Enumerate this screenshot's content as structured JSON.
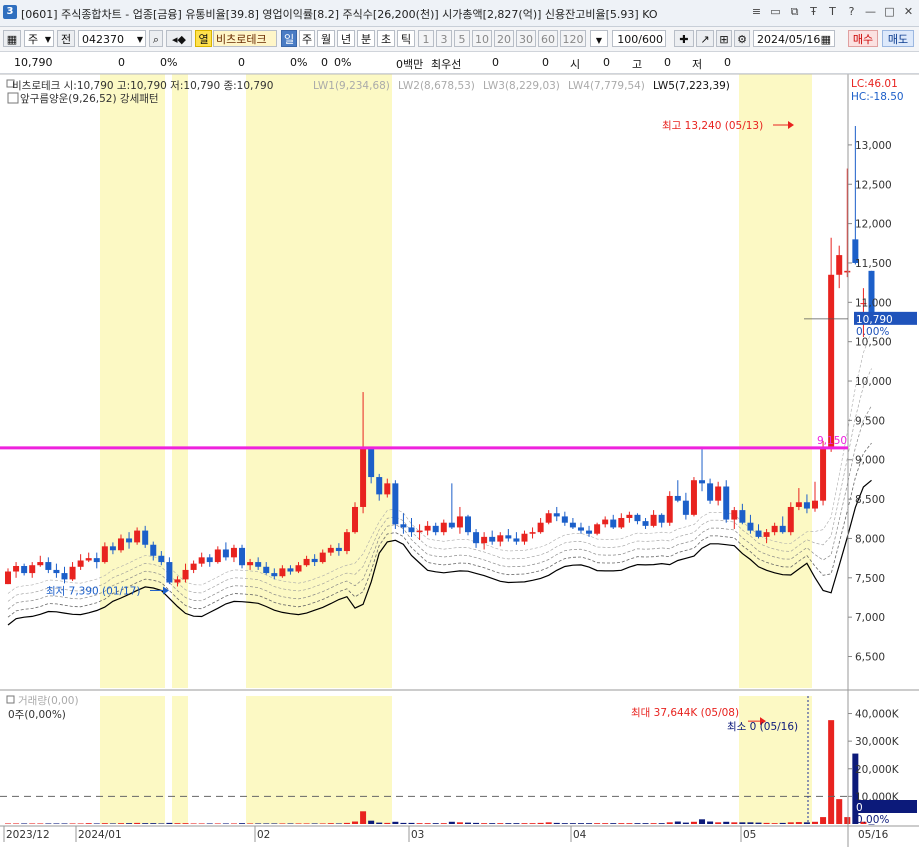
{
  "window": {
    "icon_label": "3",
    "title": "[0601] 주식종합차트 - 업종[금융] 유통비율[39.8] 영업이익률[8.2] 주식수[26,200(천)] 시가총액[2,827(억)] 신용잔고비율[5.93] KO",
    "controls": [
      "≡",
      "▭",
      "⧉",
      "Ŧ",
      "T",
      "?",
      "—",
      "□",
      "✕"
    ]
  },
  "toolbar": {
    "type_select": "주",
    "prev_label": "전",
    "stock_code": "042370",
    "open_label": "열",
    "stock_name": "비츠로테크",
    "periods": [
      "일",
      "주",
      "월",
      "년",
      "분",
      "초",
      "틱"
    ],
    "active_period": "일",
    "intervals": [
      "1",
      "3",
      "5",
      "10",
      "20",
      "30",
      "60",
      "120"
    ],
    "count": "100",
    "count_total": "/600",
    "date": "2024/05/16",
    "buy_label": "매수",
    "sell_label": "매도"
  },
  "quote": {
    "price": "10,790",
    "change": "0",
    "change_pct": "0%",
    "open_val": "0",
    "open_pct": "0%",
    "vol_val": "0",
    "vol_pct": "0%",
    "amount": "0백만",
    "best_label": "최우선",
    "best_val": "0",
    "f1": "0",
    "si_label": "시",
    "si_val": "0",
    "go_label": "고",
    "go_val": "0",
    "jeo_label": "저",
    "jeo_val": "0"
  },
  "chart_data": {
    "type": "candlestick",
    "price_header": "비츠로테크 시:10,790 고:10,790 저:10,790 종:10,790",
    "lw_labels": [
      "LW1(9,234,68)",
      "LW2(8,678,53)",
      "LW3(8,229,03)",
      "LW4(7,779,54)",
      "LW5(7,223,39)"
    ],
    "pattern_label": "앞구름양운(9,26,52) 강세패턴",
    "lc_label": "LC:46.01",
    "hc_label": "HC:-18.50",
    "price_ticks": [
      13000,
      12500,
      12000,
      11500,
      11000,
      10500,
      10000,
      9500,
      9000,
      8500,
      8000,
      7500,
      7000,
      6500
    ],
    "price_tick_labels": [
      "13,000",
      "12,500",
      "12,000",
      "11,500",
      "11,000",
      "10,500",
      "10,000",
      "9,500",
      "9,000",
      "8,500",
      "8,000",
      "7,500",
      "7,000",
      "6,500"
    ],
    "ylim": [
      6100,
      13850
    ],
    "current_price": 10790,
    "current_price_label": "10,790",
    "current_change_label": "0.00%",
    "resistance": 9150,
    "resistance_label": "9,150",
    "high_label": "최고 13,240 (05/13)",
    "low_label": "최저 7,390 (01/17)",
    "x_labels": [
      "2023/12",
      "2024/01",
      "02",
      "03",
      "04",
      "05"
    ],
    "x_right_label": "05/16",
    "volume_title": "거래량(0,00)",
    "volume_sub": "0주(0,00%)",
    "volume_ticks": [
      "40,000K",
      "30,000K",
      "20,000K",
      "10,000K"
    ],
    "volume_max_label": "최대 37,644K (05/08)",
    "volume_min_label": "최소 0 (05/16)",
    "volume_current": "0",
    "volume_current_pct": "0.00%",
    "candles": [
      [
        7420,
        7620,
        7420,
        7580
      ],
      [
        7580,
        7700,
        7500,
        7650
      ],
      [
        7650,
        7680,
        7530,
        7560
      ],
      [
        7560,
        7700,
        7500,
        7660
      ],
      [
        7660,
        7780,
        7640,
        7700
      ],
      [
        7700,
        7760,
        7560,
        7600
      ],
      [
        7600,
        7680,
        7500,
        7560
      ],
      [
        7560,
        7640,
        7430,
        7480
      ],
      [
        7480,
        7700,
        7460,
        7640
      ],
      [
        7640,
        7800,
        7600,
        7720
      ],
      [
        7720,
        7820,
        7700,
        7750
      ],
      [
        7750,
        7820,
        7620,
        7700
      ],
      [
        7700,
        7950,
        7680,
        7900
      ],
      [
        7900,
        7950,
        7800,
        7850
      ],
      [
        7850,
        8050,
        7820,
        8000
      ],
      [
        8000,
        8080,
        7870,
        7950
      ],
      [
        7950,
        8140,
        7920,
        8100
      ],
      [
        8100,
        8160,
        7880,
        7920
      ],
      [
        7920,
        7960,
        7720,
        7780
      ],
      [
        7780,
        7840,
        7660,
        7700
      ],
      [
        7700,
        7760,
        7420,
        7440
      ],
      [
        7440,
        7520,
        7390,
        7480
      ],
      [
        7480,
        7680,
        7440,
        7600
      ],
      [
        7600,
        7720,
        7560,
        7680
      ],
      [
        7680,
        7820,
        7640,
        7760
      ],
      [
        7760,
        7800,
        7640,
        7700
      ],
      [
        7700,
        7900,
        7680,
        7860
      ],
      [
        7860,
        7950,
        7720,
        7760
      ],
      [
        7760,
        7920,
        7700,
        7880
      ],
      [
        7880,
        7920,
        7620,
        7660
      ],
      [
        7660,
        7740,
        7600,
        7700
      ],
      [
        7700,
        7760,
        7600,
        7640
      ],
      [
        7640,
        7700,
        7540,
        7560
      ],
      [
        7560,
        7620,
        7480,
        7520
      ],
      [
        7520,
        7660,
        7500,
        7620
      ],
      [
        7620,
        7660,
        7540,
        7580
      ],
      [
        7580,
        7700,
        7560,
        7660
      ],
      [
        7660,
        7780,
        7640,
        7740
      ],
      [
        7740,
        7800,
        7650,
        7700
      ],
      [
        7700,
        7860,
        7680,
        7820
      ],
      [
        7820,
        7920,
        7780,
        7880
      ],
      [
        7880,
        7940,
        7780,
        7840
      ],
      [
        7840,
        8120,
        7800,
        8080
      ],
      [
        8080,
        8460,
        8060,
        8400
      ],
      [
        8400,
        9860,
        8320,
        9150
      ],
      [
        9150,
        9160,
        8700,
        8780
      ],
      [
        8780,
        8820,
        8480,
        8560
      ],
      [
        8560,
        8760,
        8520,
        8700
      ],
      [
        8700,
        8740,
        8120,
        8180
      ],
      [
        8180,
        8320,
        8060,
        8140
      ],
      [
        8140,
        8260,
        8020,
        8080
      ],
      [
        8080,
        8180,
        7980,
        8100
      ],
      [
        8100,
        8220,
        8040,
        8160
      ],
      [
        8160,
        8200,
        8040,
        8080
      ],
      [
        8080,
        8240,
        8040,
        8200
      ],
      [
        8200,
        8700,
        8120,
        8140
      ],
      [
        8140,
        8400,
        8060,
        8280
      ],
      [
        8280,
        8300,
        8040,
        8080
      ],
      [
        8080,
        8120,
        7880,
        7940
      ],
      [
        7940,
        8080,
        7860,
        8020
      ],
      [
        8020,
        8100,
        7920,
        7960
      ],
      [
        7960,
        8080,
        7900,
        8040
      ],
      [
        8040,
        8120,
        7960,
        8000
      ],
      [
        8000,
        8080,
        7920,
        7960
      ],
      [
        7960,
        8100,
        7920,
        8060
      ],
      [
        8060,
        8140,
        8000,
        8080
      ],
      [
        8080,
        8260,
        8060,
        8200
      ],
      [
        8200,
        8360,
        8180,
        8320
      ],
      [
        8320,
        8400,
        8220,
        8280
      ],
      [
        8280,
        8340,
        8160,
        8200
      ],
      [
        8200,
        8260,
        8120,
        8140
      ],
      [
        8140,
        8200,
        8060,
        8100
      ],
      [
        8100,
        8160,
        8020,
        8060
      ],
      [
        8060,
        8200,
        8040,
        8180
      ],
      [
        8180,
        8280,
        8140,
        8240
      ],
      [
        8240,
        8300,
        8120,
        8140
      ],
      [
        8140,
        8320,
        8120,
        8260
      ],
      [
        8260,
        8340,
        8200,
        8300
      ],
      [
        8300,
        8320,
        8180,
        8220
      ],
      [
        8220,
        8260,
        8120,
        8160
      ],
      [
        8160,
        8360,
        8140,
        8300
      ],
      [
        8300,
        8320,
        8140,
        8200
      ],
      [
        8200,
        8600,
        8160,
        8540
      ],
      [
        8540,
        8740,
        8460,
        8480
      ],
      [
        8480,
        8580,
        8240,
        8300
      ],
      [
        8300,
        8780,
        8280,
        8740
      ],
      [
        8740,
        9160,
        8600,
        8700
      ],
      [
        8700,
        8760,
        8440,
        8480
      ],
      [
        8480,
        8720,
        8420,
        8660
      ],
      [
        8660,
        8740,
        8200,
        8240
      ],
      [
        8240,
        8400,
        8120,
        8360
      ],
      [
        8360,
        8440,
        8180,
        8200
      ],
      [
        8200,
        8300,
        8060,
        8100
      ],
      [
        8100,
        8180,
        8000,
        8020
      ],
      [
        8020,
        8120,
        7940,
        8080
      ],
      [
        8080,
        8200,
        8040,
        8160
      ],
      [
        8160,
        8280,
        8060,
        8080
      ],
      [
        8080,
        8460,
        8040,
        8400
      ],
      [
        8400,
        8640,
        8360,
        8460
      ],
      [
        8460,
        8560,
        8320,
        8380
      ],
      [
        8380,
        8720,
        8340,
        8480
      ],
      [
        8480,
        9240,
        8420,
        9150
      ],
      [
        9150,
        11820,
        9100,
        11350
      ],
      [
        11350,
        11720,
        11180,
        11600
      ],
      [
        11380,
        12700,
        11320,
        11400
      ],
      [
        11800,
        13240,
        11480,
        11500
      ],
      [
        10980,
        11180,
        10560,
        10990
      ],
      [
        11400,
        11400,
        10720,
        10790
      ]
    ],
    "volume": [
      0.2,
      0.2,
      0.2,
      0.2,
      0.2,
      0.2,
      0.2,
      0.2,
      0.2,
      0.2,
      0.3,
      0.2,
      0.3,
      0.2,
      0.3,
      0.3,
      0.4,
      0.3,
      0.3,
      0.2,
      0.4,
      0.3,
      0.3,
      0.2,
      0.2,
      0.2,
      0.2,
      0.2,
      0.2,
      0.3,
      0.2,
      0.2,
      0.2,
      0.2,
      0.2,
      0.2,
      0.2,
      0.2,
      0.2,
      0.2,
      0.3,
      0.2,
      0.4,
      0.9,
      4.6,
      1.2,
      0.5,
      0.4,
      0.8,
      0.4,
      0.4,
      0.3,
      0.3,
      0.3,
      0.3,
      0.8,
      0.6,
      0.5,
      0.4,
      0.3,
      0.3,
      0.3,
      0.3,
      0.3,
      0.3,
      0.3,
      0.4,
      0.6,
      0.4,
      0.3,
      0.3,
      0.3,
      0.3,
      0.3,
      0.3,
      0.3,
      0.3,
      0.3,
      0.3,
      0.3,
      0.3,
      0.3,
      0.6,
      0.9,
      0.5,
      0.8,
      1.7,
      0.9,
      0.6,
      0.8,
      0.6,
      0.6,
      0.6,
      0.5,
      0.4,
      0.3,
      0.4,
      0.6,
      0.7,
      0.6,
      0.8,
      2.5,
      37.6,
      9.0,
      2.5,
      25.5,
      0.8,
      0.0
    ]
  },
  "colors": {
    "up": "#e8231f",
    "down": "#1c5fc9",
    "resistance": "#ee22dd",
    "band": "#fcf9c4",
    "volume_down": "#0c1a7a",
    "label_box": "#1f53bb"
  }
}
